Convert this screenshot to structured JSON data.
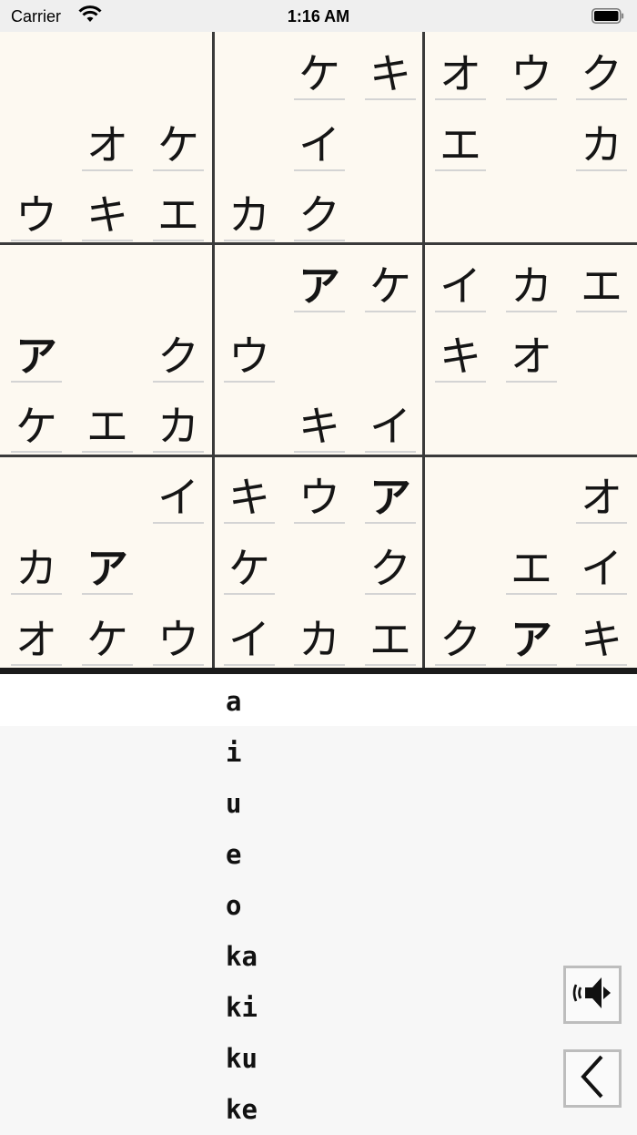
{
  "status_bar": {
    "carrier": "Carrier",
    "time": "1:16 AM"
  },
  "board": {
    "cells": [
      [
        "",
        "",
        "",
        "",
        "ケ",
        "キ",
        "オ",
        "ウ",
        "ク"
      ],
      [
        "",
        "オ",
        "ケ",
        "",
        "イ",
        "",
        "エ",
        "",
        "カ"
      ],
      [
        "ウ",
        "キ",
        "エ",
        "カ",
        "ク",
        "",
        "",
        "",
        ""
      ],
      [
        "",
        "",
        "",
        "",
        "ア",
        "ケ",
        "イ",
        "カ",
        "エ"
      ],
      [
        "ア",
        "",
        "ク",
        "ウ",
        "",
        "",
        "キ",
        "オ",
        ""
      ],
      [
        "ケ",
        "エ",
        "カ",
        "",
        "キ",
        "イ",
        "",
        "",
        ""
      ],
      [
        "",
        "",
        "イ",
        "キ",
        "ウ",
        "ア",
        "",
        "",
        "オ"
      ],
      [
        "カ",
        "ア",
        "",
        "ケ",
        "",
        "ク",
        "",
        "エ",
        "イ"
      ],
      [
        "オ",
        "ケ",
        "ウ",
        "イ",
        "カ",
        "エ",
        "ク",
        "ア",
        "キ"
      ]
    ]
  },
  "picker": {
    "items": [
      "a",
      "i",
      "u",
      "e",
      "o",
      "ka",
      "ki",
      "ku",
      "ke"
    ],
    "selected_index": 0
  },
  "controls": {
    "sound_icon": "speaker-icon",
    "back_icon": "chevron-left-icon"
  }
}
